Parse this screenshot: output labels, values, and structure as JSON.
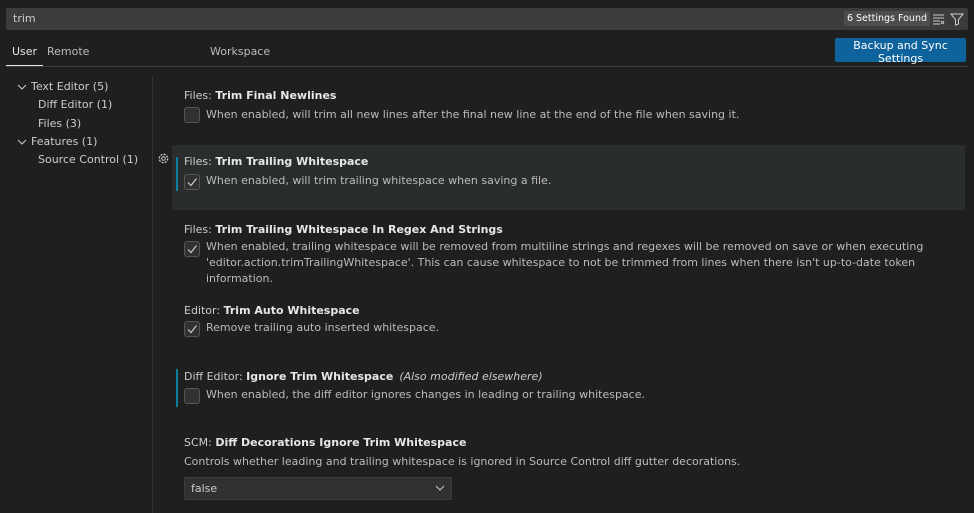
{
  "search": {
    "value": "trim",
    "results": "6 Settings Found",
    "icons": [
      "clear-filter-icon",
      "filter-icon"
    ]
  },
  "tabs": [
    {
      "label": "User",
      "active": true
    },
    {
      "label": "Remote"
    },
    {
      "label": "Workspace"
    }
  ],
  "sync_button": "Backup and Sync Settings",
  "tree": [
    {
      "label": "Text Editor (5)",
      "expanded": true
    },
    {
      "label": "Diff Editor (1)"
    },
    {
      "label": "Files (3)"
    },
    {
      "label": "Features (1)",
      "expanded": true
    },
    {
      "label": "Source Control (1)"
    }
  ],
  "settings": [
    {
      "category": "Files: ",
      "name": "Trim Final Newlines",
      "checked": false,
      "description": "When enabled, will trim all new lines after the final new line at the end of the file when saving it."
    },
    {
      "category": "Files: ",
      "name": "Trim Trailing Whitespace",
      "checked": true,
      "modified": true,
      "description": "When enabled, will trim trailing whitespace when saving a file."
    },
    {
      "category": "Files: ",
      "name": "Trim Trailing Whitespace In Regex And Strings",
      "checked": true,
      "description": "When enabled, trailing whitespace will be removed from multiline strings and regexes will be removed on save or when executing 'editor.action.trimTrailingWhitespace'. This can cause whitespace to not be trimmed from lines when there isn't up-to-date token information."
    },
    {
      "category": "Editor: ",
      "name": "Trim Auto Whitespace",
      "checked": true,
      "description": "Remove trailing auto inserted whitespace."
    },
    {
      "category": "Diff Editor: ",
      "name": "Ignore Trim Whitespace",
      "checked": false,
      "modified": true,
      "note": "(Also modified elsewhere)",
      "description": "When enabled, the diff editor ignores changes in leading or trailing whitespace."
    },
    {
      "category": "SCM: ",
      "name": "Diff Decorations Ignore Trim Whitespace",
      "description": "Controls whether leading and trailing whitespace is ignored in Source Control diff gutter decorations.",
      "value": "false"
    }
  ],
  "colors": {
    "accent": "#0e639c",
    "modified_bar": "#0c7d9d",
    "background": "#1f1f1f"
  }
}
